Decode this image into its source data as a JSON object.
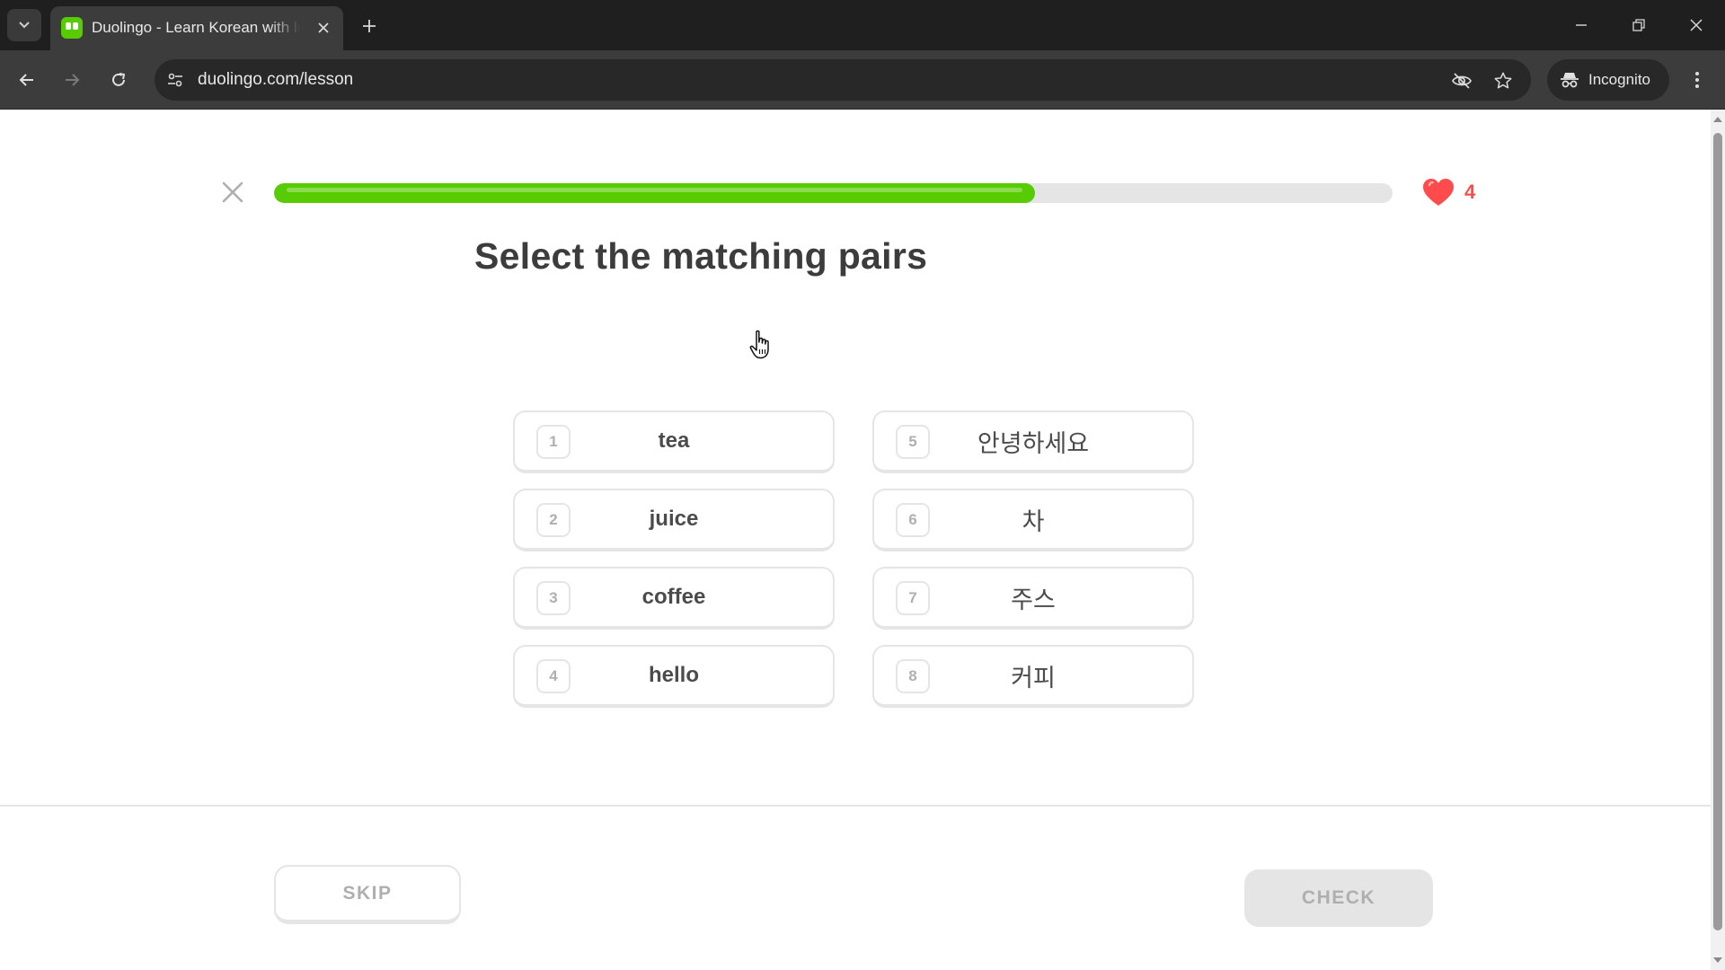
{
  "browser": {
    "tab": {
      "title": "Duolingo - Learn Korean with le"
    },
    "url": "duolingo.com/lesson",
    "incognito_label": "Incognito"
  },
  "lesson": {
    "progress": 0.68,
    "hearts": "4",
    "prompt": "Select the matching pairs",
    "left_choices": [
      {
        "num": "1",
        "text": "tea"
      },
      {
        "num": "2",
        "text": "juice"
      },
      {
        "num": "3",
        "text": "coffee"
      },
      {
        "num": "4",
        "text": "hello"
      }
    ],
    "right_choices": [
      {
        "num": "5",
        "text": "안녕하세요"
      },
      {
        "num": "6",
        "text": "차"
      },
      {
        "num": "7",
        "text": "주스"
      },
      {
        "num": "8",
        "text": "커피"
      }
    ],
    "skip_label": "SKIP",
    "check_label": "CHECK"
  },
  "colors": {
    "accent_green": "#58cc02",
    "heart_red": "#ff4b4b",
    "border_gray": "#e5e5e5"
  }
}
